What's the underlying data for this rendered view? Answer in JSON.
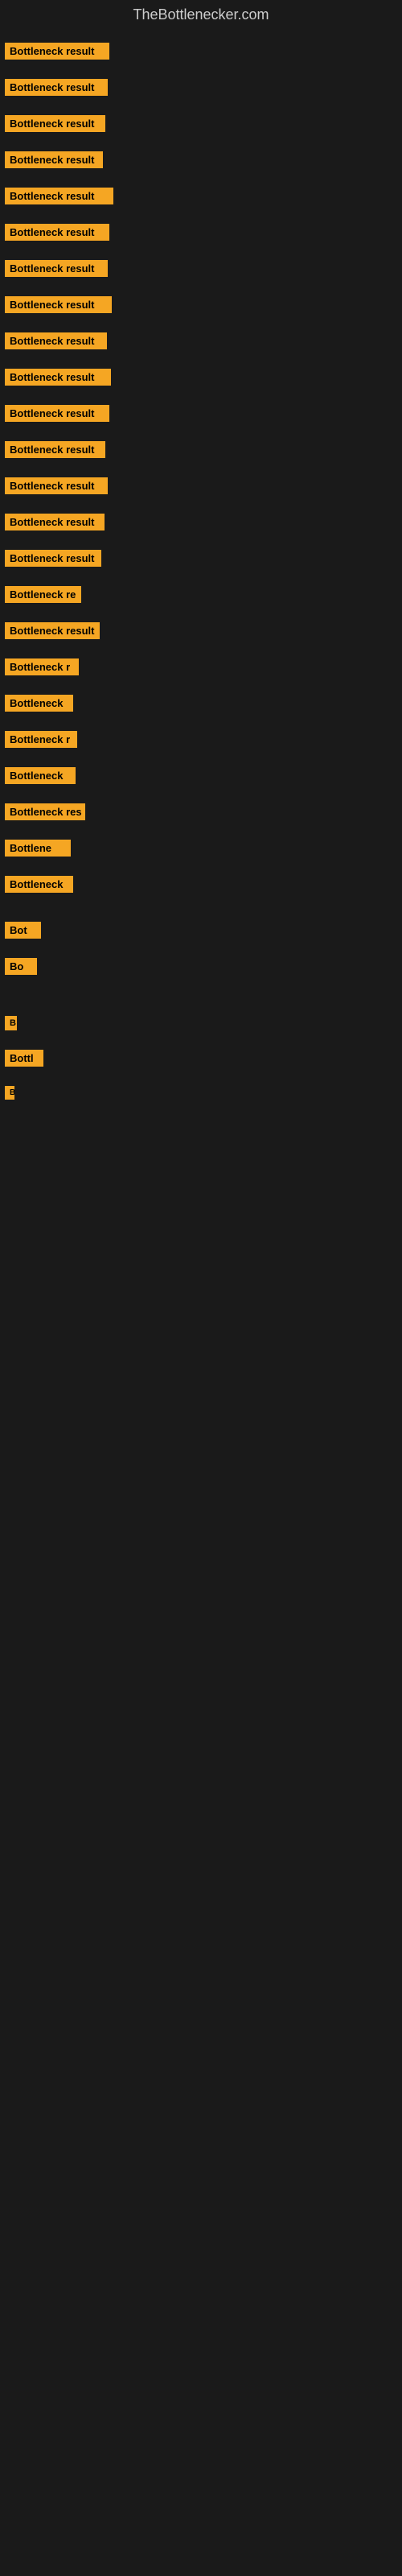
{
  "site": {
    "title": "TheBottlenecker.com"
  },
  "rows": [
    {
      "id": 1,
      "label": "Bottleneck result"
    },
    {
      "id": 2,
      "label": "Bottleneck result"
    },
    {
      "id": 3,
      "label": "Bottleneck result"
    },
    {
      "id": 4,
      "label": "Bottleneck result"
    },
    {
      "id": 5,
      "label": "Bottleneck result"
    },
    {
      "id": 6,
      "label": "Bottleneck result"
    },
    {
      "id": 7,
      "label": "Bottleneck result"
    },
    {
      "id": 8,
      "label": "Bottleneck result"
    },
    {
      "id": 9,
      "label": "Bottleneck result"
    },
    {
      "id": 10,
      "label": "Bottleneck result"
    },
    {
      "id": 11,
      "label": "Bottleneck result"
    },
    {
      "id": 12,
      "label": "Bottleneck result"
    },
    {
      "id": 13,
      "label": "Bottleneck result"
    },
    {
      "id": 14,
      "label": "Bottleneck result"
    },
    {
      "id": 15,
      "label": "Bottleneck result"
    },
    {
      "id": 16,
      "label": "Bottleneck re"
    },
    {
      "id": 17,
      "label": "Bottleneck result"
    },
    {
      "id": 18,
      "label": "Bottleneck r"
    },
    {
      "id": 19,
      "label": "Bottleneck"
    },
    {
      "id": 20,
      "label": "Bottleneck r"
    },
    {
      "id": 21,
      "label": "Bottleneck"
    },
    {
      "id": 22,
      "label": "Bottleneck res"
    },
    {
      "id": 23,
      "label": "Bottlene"
    },
    {
      "id": 24,
      "label": "Bottleneck"
    },
    {
      "id": 25,
      "label": "Bot"
    },
    {
      "id": 26,
      "label": "Bo"
    },
    {
      "id": 27,
      "label": "B"
    },
    {
      "id": 28,
      "label": "Bottl"
    },
    {
      "id": 29,
      "label": "B"
    }
  ],
  "colors": {
    "badge_bg": "#f5a623",
    "badge_text": "#000000",
    "page_bg": "#1a1a1a",
    "title_color": "#cccccc"
  }
}
